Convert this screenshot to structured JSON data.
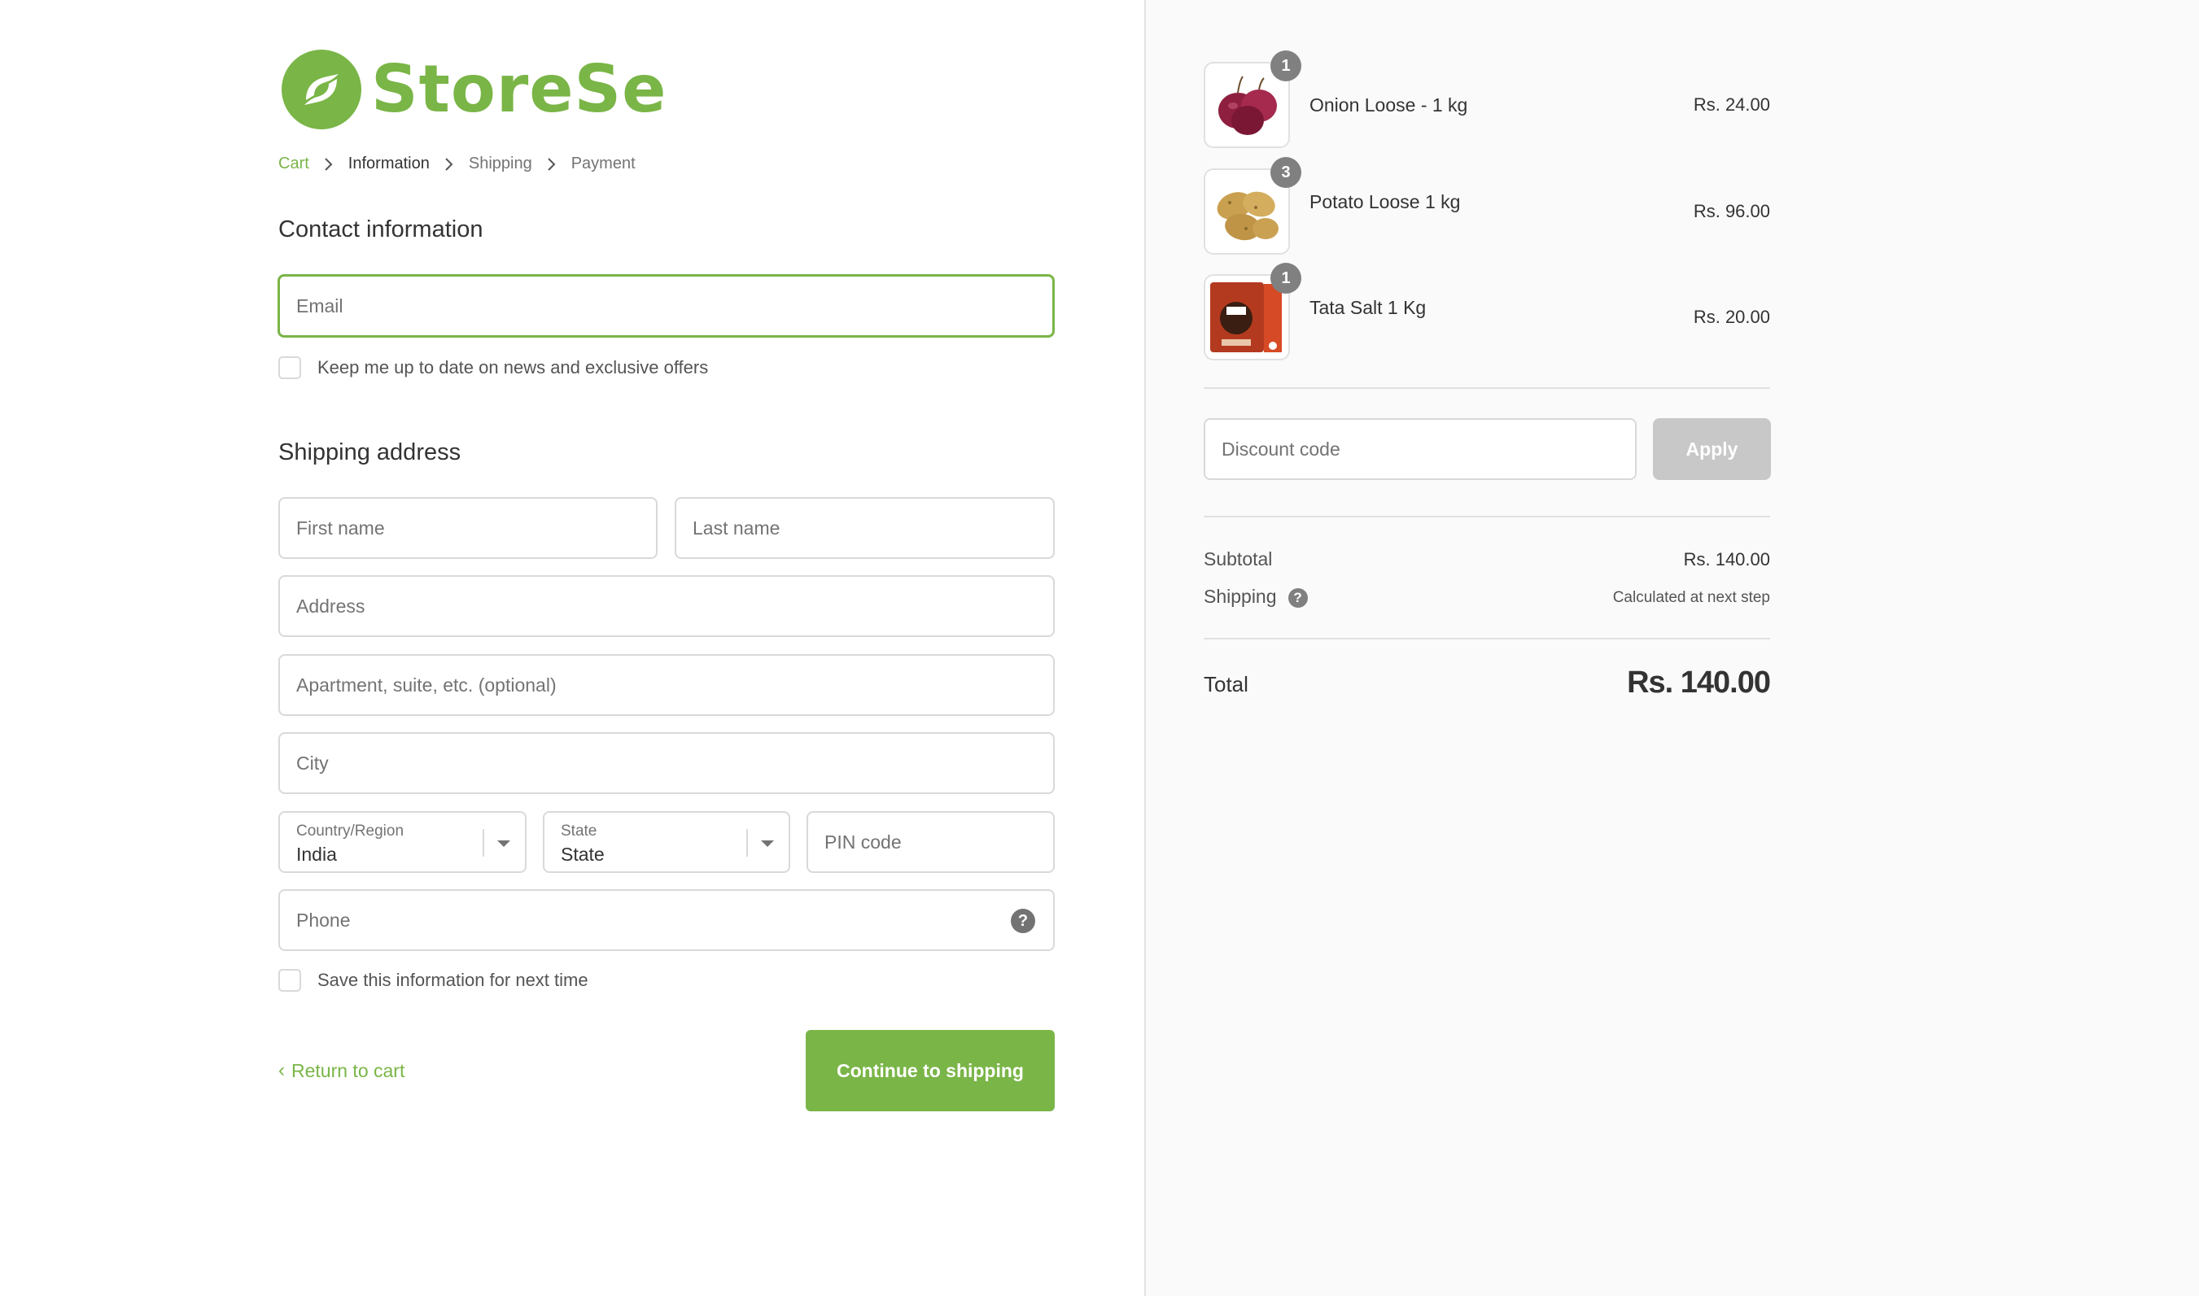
{
  "brand": {
    "name": "StoreSe",
    "accent": "#7ab547"
  },
  "breadcrumb": [
    "Cart",
    "Information",
    "Shipping",
    "Payment"
  ],
  "contact": {
    "title": "Contact information",
    "email_placeholder": "Email",
    "newsletter_label": "Keep me up to date on news and exclusive offers"
  },
  "shipping": {
    "title": "Shipping address",
    "first_name_placeholder": "First name",
    "last_name_placeholder": "Last name",
    "address_placeholder": "Address",
    "apartment_placeholder": "Apartment, suite, etc. (optional)",
    "city_placeholder": "City",
    "country": {
      "label": "Country/Region",
      "value": "India"
    },
    "state": {
      "label": "State",
      "value": "State"
    },
    "pin_placeholder": "PIN code",
    "phone_placeholder": "Phone",
    "save_label": "Save this information for next time"
  },
  "actions": {
    "return_label": "Return to cart",
    "continue_label": "Continue to shipping"
  },
  "order": {
    "items": [
      {
        "name": "Onion Loose - 1 kg",
        "price": "Rs. 24.00",
        "qty": "1",
        "icon": "onion-image"
      },
      {
        "name": "Potato Loose 1 kg",
        "price": "Rs. 96.00",
        "qty": "3",
        "icon": "potato-image"
      },
      {
        "name": "Tata Salt 1 Kg",
        "price": "Rs. 20.00",
        "qty": "1",
        "icon": "salt-pack-image"
      }
    ],
    "discount_placeholder": "Discount code",
    "apply_label": "Apply",
    "subtotal_label": "Subtotal",
    "subtotal_value": "Rs. 140.00",
    "shipping_label": "Shipping",
    "shipping_value": "Calculated at next step",
    "total_label": "Total",
    "total_value": "Rs. 140.00"
  }
}
